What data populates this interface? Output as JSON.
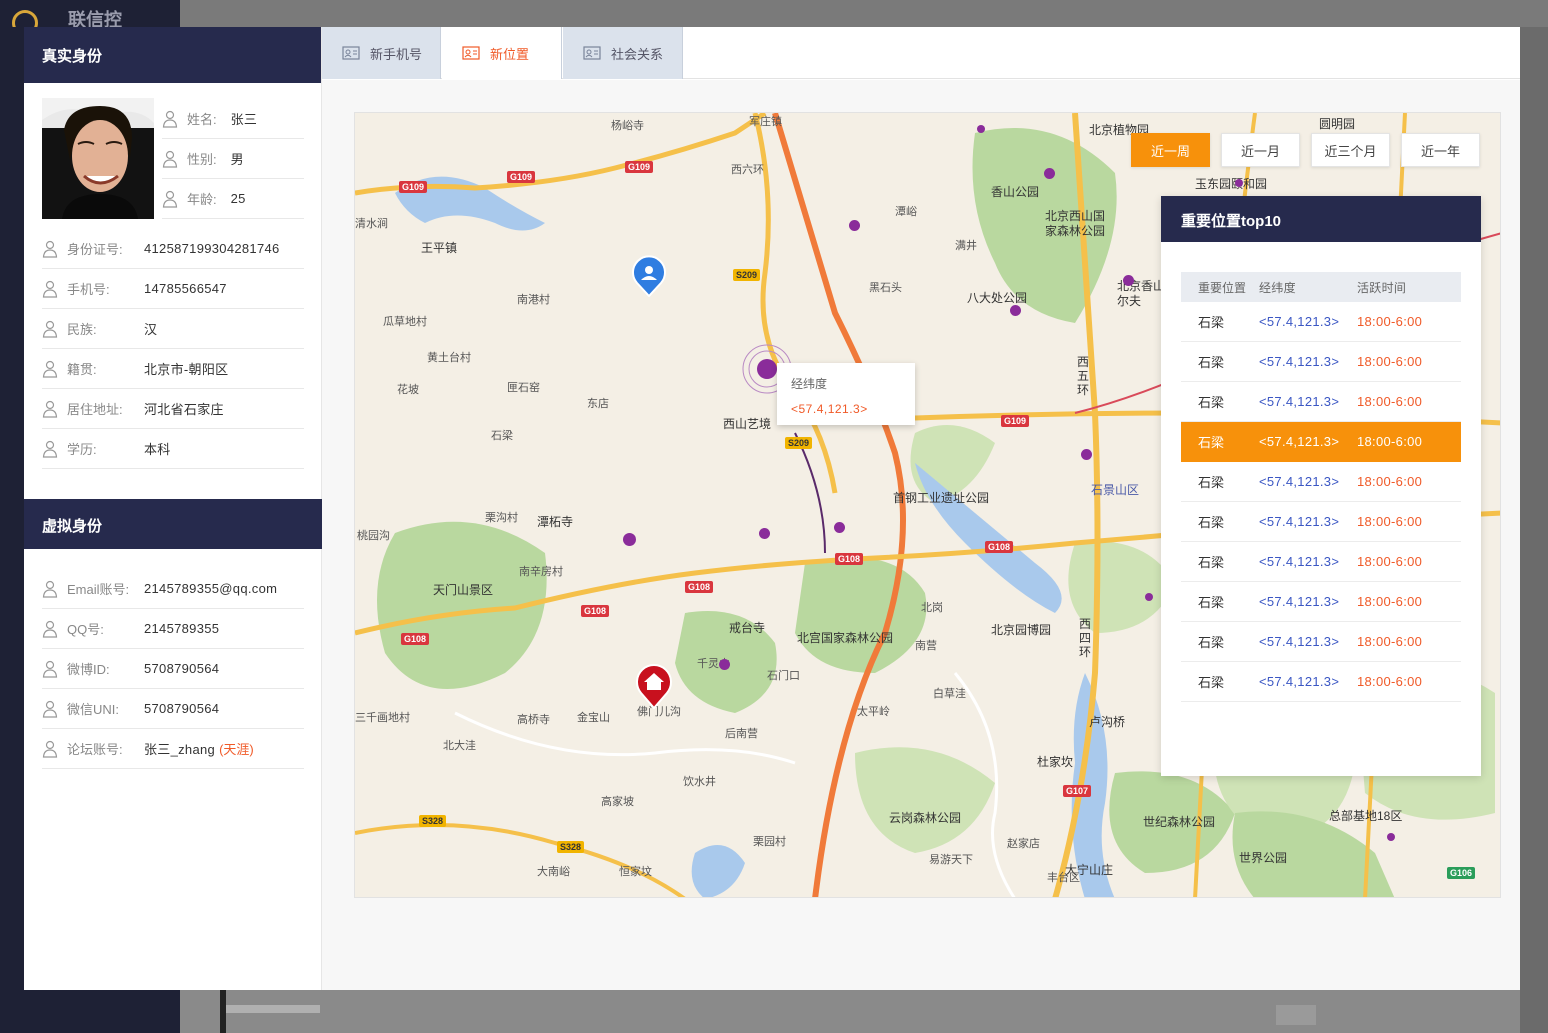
{
  "app": {
    "logo_text": "联信控"
  },
  "real_identity": {
    "title": "真实身份",
    "fields": [
      {
        "label": "姓名:",
        "value": "张三"
      },
      {
        "label": "性别:",
        "value": "男"
      },
      {
        "label": "年龄:",
        "value": "25"
      },
      {
        "label": "身份证号:",
        "value": "412587199304281746"
      },
      {
        "label": "手机号:",
        "value": "14785566547"
      },
      {
        "label": "民族:",
        "value": "汉"
      },
      {
        "label": "籍贯:",
        "value": "北京市-朝阳区"
      },
      {
        "label": "居住地址:",
        "value": "河北省石家庄"
      },
      {
        "label": "学历:",
        "value": "本科"
      }
    ]
  },
  "virtual_identity": {
    "title": "虚拟身份",
    "fields": [
      {
        "label": "Email账号:",
        "value": "2145789355@qq.com"
      },
      {
        "label": "QQ号:",
        "value": "2145789355"
      },
      {
        "label": "微博ID:",
        "value": "5708790564"
      },
      {
        "label": "微信UNI:",
        "value": "5708790564"
      },
      {
        "label": "论坛账号:",
        "value": "张三_zhang",
        "tag": "(天涯)"
      }
    ]
  },
  "tabs": [
    {
      "label": "新手机号",
      "active": false
    },
    {
      "label": "新位置",
      "active": true
    },
    {
      "label": "社会关系",
      "active": false
    }
  ],
  "range_buttons": [
    {
      "label": "近一周",
      "active": true
    },
    {
      "label": "近一月",
      "active": false
    },
    {
      "label": "近三个月",
      "active": false
    },
    {
      "label": "近一年",
      "active": false
    }
  ],
  "tooltip": {
    "title": "经纬度",
    "value": "<57.4,121.3>"
  },
  "top10": {
    "title": "重要位置top10",
    "headers": [
      "重要位置",
      "经纬度",
      "活跃时间"
    ],
    "rows": [
      {
        "place": "石梁",
        "coord": "<57.4,121.3>",
        "time": "18:00-6:00"
      },
      {
        "place": "石梁",
        "coord": "<57.4,121.3>",
        "time": "18:00-6:00"
      },
      {
        "place": "石梁",
        "coord": "<57.4,121.3>",
        "time": "18:00-6:00"
      },
      {
        "place": "石梁",
        "coord": "<57.4,121.3>",
        "time": "18:00-6:00",
        "highlight": true
      },
      {
        "place": "石梁",
        "coord": "<57.4,121.3>",
        "time": "18:00-6:00"
      },
      {
        "place": "石梁",
        "coord": "<57.4,121.3>",
        "time": "18:00-6:00"
      },
      {
        "place": "石梁",
        "coord": "<57.4,121.3>",
        "time": "18:00-6:00"
      },
      {
        "place": "石梁",
        "coord": "<57.4,121.3>",
        "time": "18:00-6:00"
      },
      {
        "place": "石梁",
        "coord": "<57.4,121.3>",
        "time": "18:00-6:00"
      },
      {
        "place": "石梁",
        "coord": "<57.4,121.3>",
        "time": "18:00-6:00"
      }
    ]
  },
  "map": {
    "places": [
      "军庄镇",
      "杨峪寺",
      "西六环",
      "王平镇",
      "清水涧",
      "南港村",
      "瓜草地村",
      "黄土台村",
      "花坡",
      "匣石窑",
      "东店",
      "石梁",
      "西山艺境",
      "黑石头",
      "满井",
      "潭峪",
      "香山公园",
      "北京西山国家森林公园",
      "八大处公园",
      "北京植物园",
      "玉东园",
      "颐和园",
      "圆明园",
      "北京香山高尔夫",
      "首钢工业遗址公园",
      "石景山区",
      "西五环",
      "潭柘寺",
      "栗沟村",
      "桃园沟",
      "南辛房村",
      "天门山景区",
      "戒台寺",
      "千灵山",
      "北宫国家森林公园",
      "北京园博园",
      "北岗",
      "南营",
      "石门口",
      "高桥寺",
      "金宝山",
      "佛门儿沟",
      "北大洼",
      "后南营",
      "太平岭",
      "白草洼",
      "卢沟桥",
      "杜家坎",
      "饮水井",
      "高家坡",
      "栗园村",
      "大南峪",
      "恒家坟",
      "云岗森林公园",
      "赵家店",
      "大宁山庄",
      "世界公园",
      "世纪森林公园",
      "总部基地18区",
      "易游天下",
      "西四环",
      "丰台区",
      "三千画地村"
    ],
    "road_shields": [
      "G109",
      "G109",
      "G109",
      "S209",
      "S209",
      "G109",
      "G108",
      "G108",
      "G108",
      "G108",
      "G108",
      "G107",
      "S328",
      "S328",
      "G106"
    ]
  },
  "colors": {
    "accent": "#f7910b",
    "header_navy": "#262a4d",
    "coord_blue": "#3b57c4",
    "time_orange": "#f05a28"
  }
}
